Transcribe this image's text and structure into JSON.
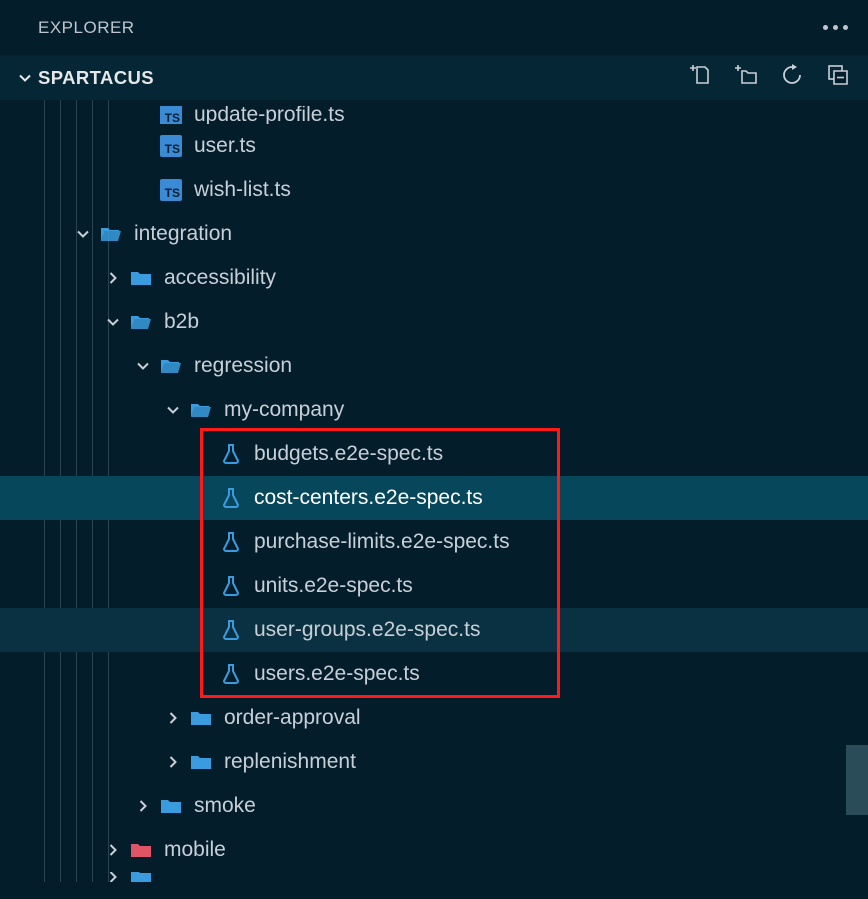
{
  "panel": {
    "title": "EXPLORER"
  },
  "section": {
    "title": "SPARTACUS"
  },
  "tree": {
    "items": [
      {
        "type": "file-partial",
        "indent": 4,
        "icon": "ts",
        "label": "update-profile.ts"
      },
      {
        "type": "file",
        "indent": 4,
        "icon": "ts",
        "label": "user.ts"
      },
      {
        "type": "file",
        "indent": 4,
        "icon": "ts",
        "label": "wish-list.ts"
      },
      {
        "type": "folder-open",
        "indent": 2,
        "chev": "down",
        "label": "integration"
      },
      {
        "type": "folder-closed",
        "indent": 3,
        "chev": "right",
        "label": "accessibility"
      },
      {
        "type": "folder-open",
        "indent": 3,
        "chev": "down",
        "label": "b2b"
      },
      {
        "type": "folder-open",
        "indent": 4,
        "chev": "down",
        "label": "regression"
      },
      {
        "type": "folder-open",
        "indent": 5,
        "chev": "down",
        "label": "my-company"
      },
      {
        "type": "file",
        "indent": 6,
        "icon": "flask",
        "label": "budgets.e2e-spec.ts",
        "boxed": true
      },
      {
        "type": "file",
        "indent": 6,
        "icon": "flask",
        "label": "cost-centers.e2e-spec.ts",
        "boxed": true,
        "selected": true
      },
      {
        "type": "file",
        "indent": 6,
        "icon": "flask",
        "label": "purchase-limits.e2e-spec.ts",
        "boxed": true
      },
      {
        "type": "file",
        "indent": 6,
        "icon": "flask",
        "label": "units.e2e-spec.ts",
        "boxed": true
      },
      {
        "type": "file",
        "indent": 6,
        "icon": "flask",
        "label": "user-groups.e2e-spec.ts",
        "boxed": true,
        "dim": true
      },
      {
        "type": "file",
        "indent": 6,
        "icon": "flask",
        "label": "users.e2e-spec.ts",
        "boxed": true
      },
      {
        "type": "folder-closed",
        "indent": 5,
        "chev": "right",
        "label": "order-approval"
      },
      {
        "type": "folder-closed",
        "indent": 5,
        "chev": "right",
        "label": "replenishment"
      },
      {
        "type": "folder-closed",
        "indent": 4,
        "chev": "right",
        "label": "smoke"
      },
      {
        "type": "folder-closed-red",
        "indent": 3,
        "chev": "right",
        "label": "mobile"
      },
      {
        "type": "folder-bottom-partial",
        "indent": 3,
        "chev": "right",
        "label": ""
      }
    ]
  }
}
